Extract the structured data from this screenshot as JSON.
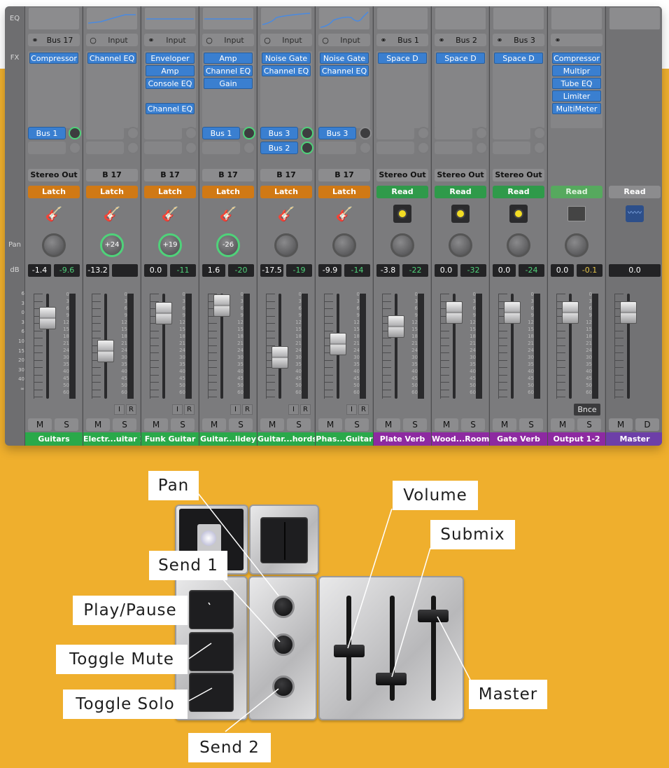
{
  "mixer": {
    "row_labels": {
      "eq": "EQ",
      "fx": "FX",
      "pan": "Pan",
      "db": "dB"
    },
    "db_scale_left": [
      "6",
      "3",
      "0",
      "3",
      "6",
      "10",
      "15",
      "20",
      "30",
      "40",
      "∞"
    ],
    "meter_scale": [
      "0",
      "3",
      "6",
      "9",
      "12",
      "15",
      "18",
      "21",
      "24",
      "30",
      "35",
      "40",
      "45",
      "50",
      "60"
    ],
    "channels": [
      {
        "input_icon": "stereo-link",
        "input": "Bus 17",
        "fx": [
          "Compressor"
        ],
        "sends": [
          "Bus 1"
        ],
        "send_active": [
          true
        ],
        "output": "Stereo Out",
        "automation": "Latch",
        "auto_color": "latch",
        "icon": "guitar-icon",
        "pan": "",
        "db1": "-1.4",
        "db2": "-9.6",
        "mute": "M",
        "solo": "S",
        "name": "Guitars",
        "name_color": "green"
      },
      {
        "input_icon": "mono",
        "input": "Input",
        "fx": [
          "Channel EQ"
        ],
        "sends": [],
        "send_active": [],
        "output": "B 17",
        "automation": "Latch",
        "auto_color": "latch",
        "icon": "electric-guitar-icon",
        "pan": "+24",
        "db1": "-13.2",
        "db2": "",
        "ir": true,
        "mute": "M",
        "solo": "S",
        "name": "Electr...uitar 1",
        "name_color": "green"
      },
      {
        "input_icon": "stereo-link",
        "input": "Input",
        "fx": [
          "Enveloper",
          "Amp",
          "Console EQ",
          "",
          "Channel EQ"
        ],
        "sends": [],
        "send_active": [],
        "output": "B 17",
        "automation": "Latch",
        "auto_color": "latch",
        "icon": "guitar-icon",
        "pan": "+19",
        "db1": "0.0",
        "db2": "-11",
        "ir": true,
        "mute": "M",
        "solo": "S",
        "name": "Funk Guitar",
        "name_color": "green"
      },
      {
        "input_icon": "mono",
        "input": "Input",
        "fx": [
          "Amp",
          "Channel EQ",
          "Gain"
        ],
        "sends": [
          "Bus 1"
        ],
        "send_active": [
          true
        ],
        "output": "B 17",
        "automation": "Latch",
        "auto_color": "latch",
        "icon": "guitar-icon",
        "pan": "-26",
        "db1": "1.6",
        "db2": "-20",
        "ir": true,
        "mute": "M",
        "solo": "S",
        "name": "Guitar...lidey",
        "name_color": "green"
      },
      {
        "input_icon": "mono",
        "input": "Input",
        "fx": [
          "Noise Gate",
          "Channel EQ"
        ],
        "sends": [
          "Bus 3",
          "Bus 2"
        ],
        "send_active": [
          true,
          true
        ],
        "output": "B 17",
        "automation": "Latch",
        "auto_color": "latch",
        "icon": "guitar-icon",
        "pan": "",
        "db1": "-17.5",
        "db2": "-19",
        "ir": true,
        "mute": "M",
        "solo": "S",
        "name": "Guitar...hords",
        "name_color": "green"
      },
      {
        "input_icon": "mono",
        "input": "Input",
        "fx": [
          "Noise Gate",
          "Channel EQ"
        ],
        "sends": [
          "Bus 3"
        ],
        "send_active": [
          false
        ],
        "output": "B 17",
        "automation": "Latch",
        "auto_color": "latch",
        "icon": "guitar-icon",
        "pan": "",
        "db1": "-9.9",
        "db2": "-14",
        "ir": true,
        "mute": "M",
        "solo": "S",
        "name": "Phas...Guitar",
        "name_color": "green"
      },
      {
        "input_icon": "stereo-link",
        "input": "Bus 1",
        "fx": [
          "Space D"
        ],
        "sends": [],
        "send_active": [],
        "output": "Stereo Out",
        "automation": "Read",
        "auto_color": "read",
        "icon": "aux-icon",
        "pan": "",
        "db1": "-3.8",
        "db2": "-22",
        "mute": "M",
        "solo": "S",
        "name": "Plate Verb",
        "name_color": "purple"
      },
      {
        "input_icon": "stereo-link",
        "input": "Bus 2",
        "fx": [
          "Space D"
        ],
        "sends": [],
        "send_active": [],
        "output": "Stereo Out",
        "automation": "Read",
        "auto_color": "read",
        "icon": "aux-icon",
        "pan": "",
        "db1": "0.0",
        "db2": "-32",
        "mute": "M",
        "solo": "S",
        "name": "Wood...Room",
        "name_color": "purple"
      },
      {
        "input_icon": "stereo-link",
        "input": "Bus 3",
        "fx": [
          "Space D"
        ],
        "sends": [],
        "send_active": [],
        "output": "Stereo Out",
        "automation": "Read",
        "auto_color": "read",
        "icon": "aux-icon",
        "pan": "",
        "db1": "0.0",
        "db2": "-24",
        "mute": "M",
        "solo": "S",
        "name": "Gate Verb",
        "name_color": "purple"
      },
      {
        "input_icon": "stereo-link",
        "input": "",
        "fx": [
          "Compressor",
          "Multipr",
          "Tube EQ",
          "Limiter",
          "MultiMeter"
        ],
        "sends": [],
        "send_active": [],
        "output": "",
        "automation": "Read",
        "auto_color": "readdark",
        "icon": "output-icon",
        "pan": "",
        "db1": "0.0",
        "db2": "-0.1",
        "db2_yellow": true,
        "bnce": "Bnce",
        "mute": "M",
        "solo": "S",
        "name": "Output 1-2",
        "name_color": "purple"
      },
      {
        "input_icon": "",
        "input": "",
        "fx": [],
        "sends": [],
        "send_active": [],
        "output": "",
        "automation": "Read",
        "auto_color": "readplain",
        "icon": "waveform-icon",
        "pan": "",
        "db1": "0.0",
        "db2": "",
        "mute": "M",
        "solo": "D",
        "name": "Master",
        "name_color": "master",
        "master": true
      }
    ]
  },
  "device": {
    "labels": {
      "pan": "Pan",
      "volume": "Volume",
      "submix": "Submix",
      "send1": "Send 1",
      "play_pause": "Play/Pause",
      "toggle_mute": "Toggle Mute",
      "toggle_solo": "Toggle Solo",
      "send2": "Send 2",
      "master": "Master"
    }
  }
}
